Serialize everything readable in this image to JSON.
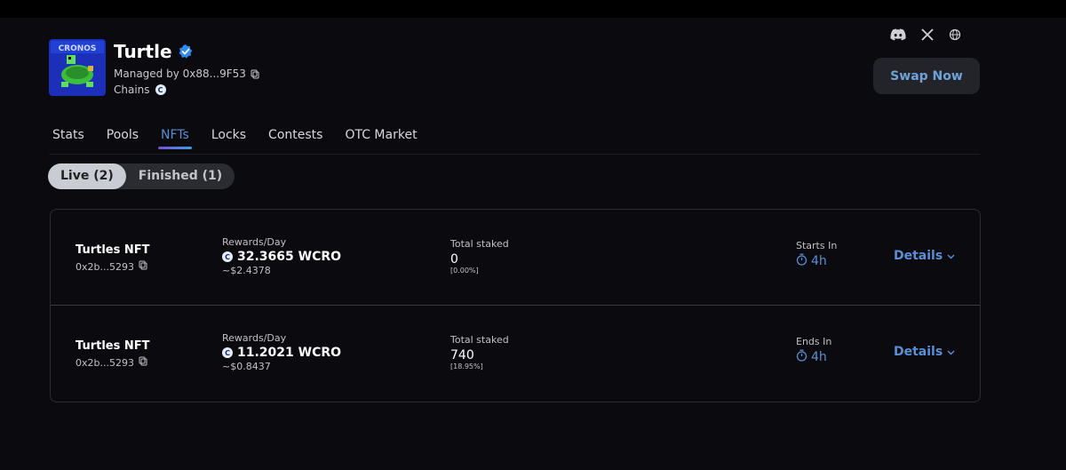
{
  "project": {
    "name": "Turtle",
    "managed_by": "Managed by 0x88...9F53",
    "chains_label": "Chains",
    "logo_text": "CRONOS"
  },
  "socials": [
    "discord-icon",
    "x-icon",
    "globe-icon"
  ],
  "swap_button": "Swap Now",
  "tabs": [
    {
      "label": "Stats"
    },
    {
      "label": "Pools"
    },
    {
      "label": "NFTs",
      "active": true
    },
    {
      "label": "Locks"
    },
    {
      "label": "Contests"
    },
    {
      "label": "OTC Market"
    }
  ],
  "toggle": {
    "live": "Live (2)",
    "finished": "Finished (1)",
    "selected": "live"
  },
  "pools": [
    {
      "name": "Turtles NFT",
      "address": "0x2b...5293",
      "rewards_label": "Rewards/Day",
      "reward": "32.3665 WCRO",
      "usd": "~$2.4378",
      "staked_label": "Total staked",
      "staked": "0",
      "staked_pct": "[0.00%]",
      "time_label": "Starts In",
      "time": "4h",
      "details": "Details"
    },
    {
      "name": "Turtles NFT",
      "address": "0x2b...5293",
      "rewards_label": "Rewards/Day",
      "reward": "11.2021 WCRO",
      "usd": "~$0.8437",
      "staked_label": "Total staked",
      "staked": "740",
      "staked_pct": "[18.95%]",
      "time_label": "Ends In",
      "time": "4h",
      "details": "Details"
    }
  ],
  "colors": {
    "accent": "#5a8fd6",
    "background": "#0b0a0f",
    "card_border": "#2a2c33"
  }
}
